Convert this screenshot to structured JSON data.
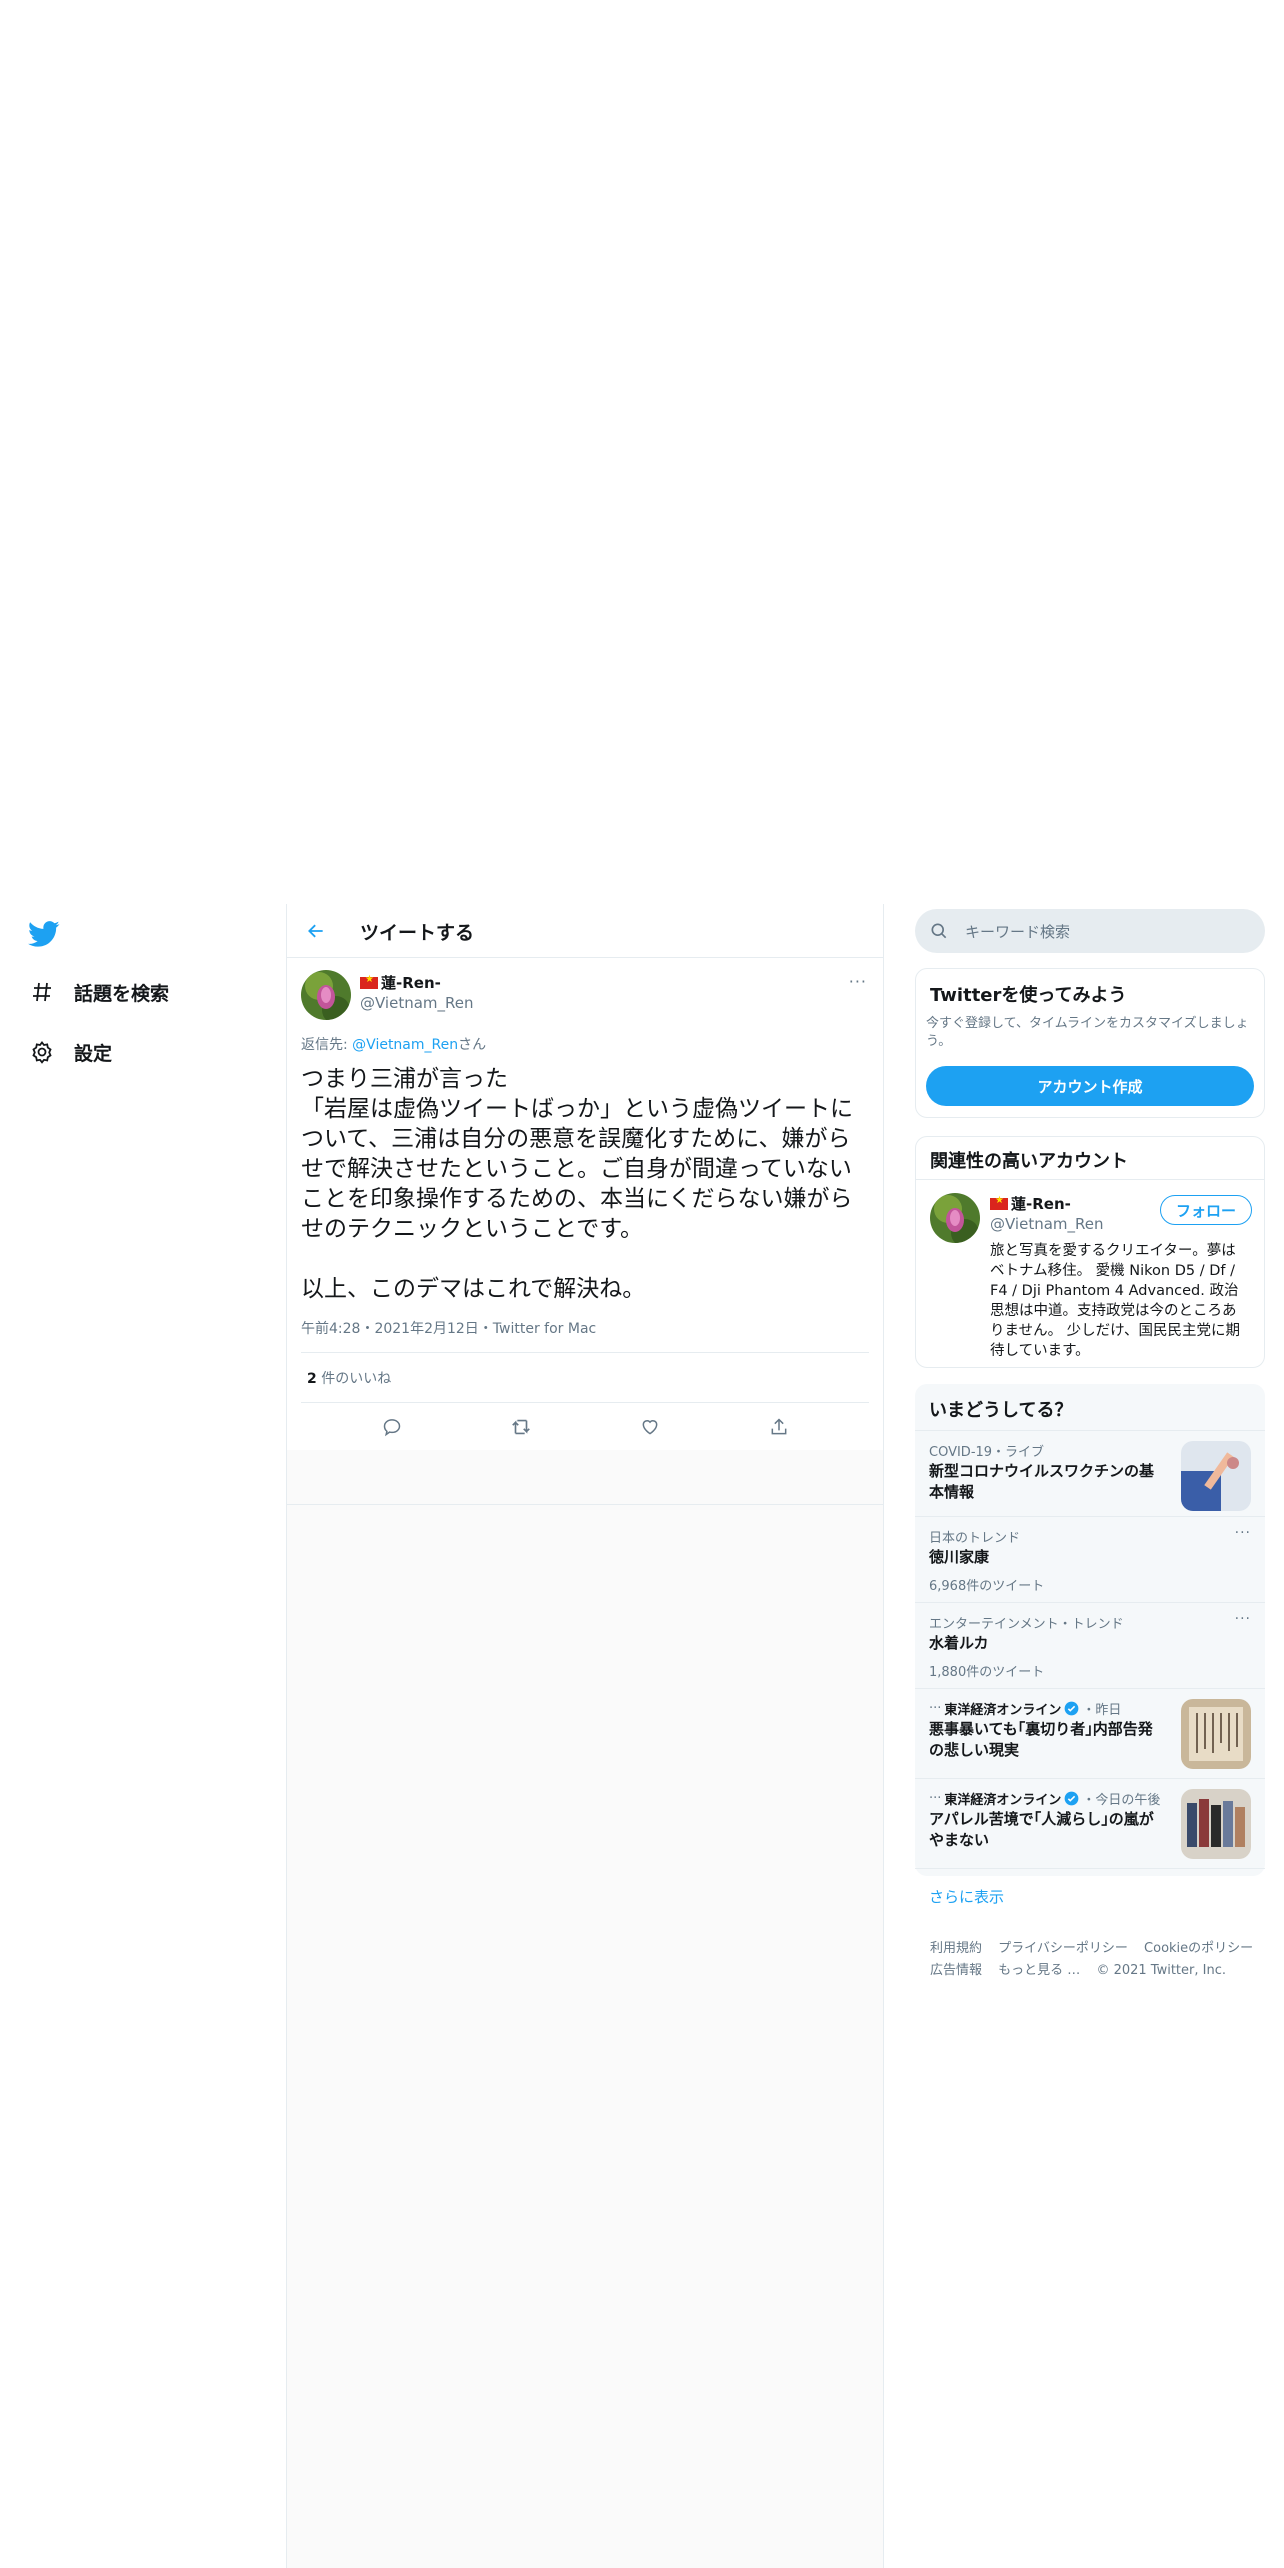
{
  "nav": {
    "items": [
      {
        "label": "話題を検索",
        "icon": "hashtag-icon"
      },
      {
        "label": "設定",
        "icon": "gear-icon"
      }
    ]
  },
  "header": {
    "title": "ツイートする"
  },
  "tweet": {
    "display_name": "蓮-Ren-",
    "handle": "@Vietnam_Ren",
    "reply_prefix": "返信先: ",
    "reply_to": "@Vietnam_Ren",
    "reply_suffix": "さん",
    "text": "つまり三浦が言った\n「岩屋は虚偽ツイートばっか」という虚偽ツイートについて、三浦は自分の悪意を誤魔化すために、嫌がらせで解決させたということ。ご自身が間違っていないことを印象操作するための、本当にくだらない嫌がらせのテクニックということです。\n\n以上、このデマはこれで解決ね。",
    "meta": "午前4:28・2021年2月12日・Twitter for Mac",
    "like_count": "2",
    "like_label": " 件のいいね",
    "more": "···"
  },
  "search": {
    "placeholder": "キーワード検索"
  },
  "signup": {
    "title": "Twitterを使ってみよう",
    "desc": "今すぐ登録して、タイムラインをカスタマイズしましょう。",
    "button": "アカウント作成"
  },
  "related": {
    "title": "関連性の高いアカウント",
    "name": "蓮-Ren-",
    "handle": "@Vietnam_Ren",
    "follow": "フォロー",
    "bio": "旅と写真を愛するクリエイター。夢はベトナム移住。 愛機 Nikon D5 / Df / F4 / Dji Phantom 4 Advanced. 政治思想は中道。支持政党は今のところありません。 少しだけ、国民民主党に期待しています。"
  },
  "trends": {
    "title": "いまどうしてる？",
    "items": [
      {
        "category": "COVID-19・ライブ",
        "title": "新型コロナウイルスワクチンの基本情報"
      },
      {
        "category": "日本のトレンド",
        "title": "徳川家康",
        "count": "6,968件のツイート",
        "more": "···"
      },
      {
        "category": "エンターテインメント・トレンド",
        "title": "水着ルカ",
        "count": "1,880件のツイート",
        "more": "···"
      },
      {
        "source": "東洋経済オンライン",
        "time": "・昨日",
        "title": "悪事暴いても｢裏切り者｣内部告発の悲しい現実"
      },
      {
        "source": "東洋経済オンライン",
        "time": "・今日の午後",
        "title": "アパレル苦境で｢人減らし｣の嵐がやまない"
      }
    ],
    "show_more": "さらに表示"
  },
  "footer": {
    "line1": [
      "利用規約",
      "プライバシーポリシー",
      "Cookieのポリシー"
    ],
    "line2": [
      "広告情報",
      "もっと見る …",
      "© 2021 Twitter, Inc."
    ]
  },
  "colors": {
    "accent": "#1da1f2",
    "muted": "#657786",
    "border": "#e6ecf0"
  }
}
